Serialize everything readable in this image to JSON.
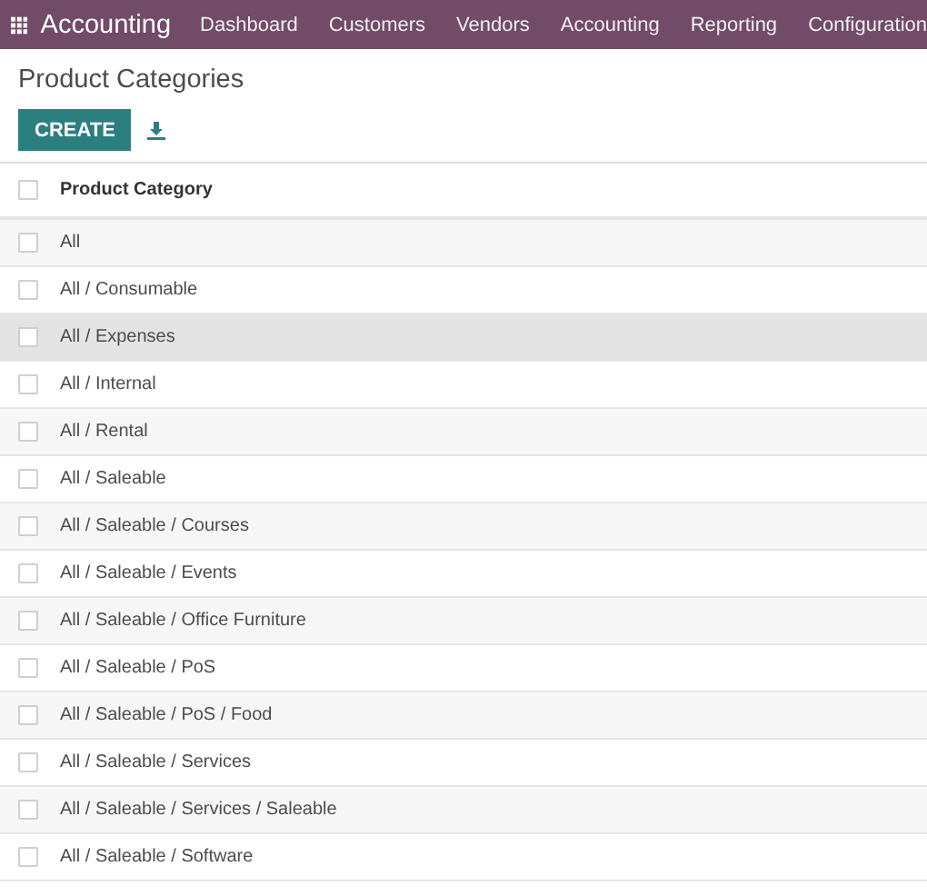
{
  "navbar": {
    "app_name": "Accounting",
    "menu": [
      "Dashboard",
      "Customers",
      "Vendors",
      "Accounting",
      "Reporting",
      "Configuration"
    ]
  },
  "page": {
    "title": "Product Categories",
    "create_button": "CREATE"
  },
  "table": {
    "columns": [
      "Product Category"
    ],
    "header_checked": false,
    "rows": [
      {
        "name": "All",
        "checked": false,
        "hovered": false
      },
      {
        "name": "All / Consumable",
        "checked": false,
        "hovered": false
      },
      {
        "name": "All / Expenses",
        "checked": false,
        "hovered": true
      },
      {
        "name": "All / Internal",
        "checked": false,
        "hovered": false
      },
      {
        "name": "All / Rental",
        "checked": false,
        "hovered": false
      },
      {
        "name": "All / Saleable",
        "checked": false,
        "hovered": false
      },
      {
        "name": "All / Saleable / Courses",
        "checked": false,
        "hovered": false
      },
      {
        "name": "All / Saleable / Events",
        "checked": false,
        "hovered": false
      },
      {
        "name": "All / Saleable / Office Furniture",
        "checked": false,
        "hovered": false
      },
      {
        "name": "All / Saleable / PoS",
        "checked": false,
        "hovered": false
      },
      {
        "name": "All / Saleable / PoS / Food",
        "checked": false,
        "hovered": false
      },
      {
        "name": "All / Saleable / Services",
        "checked": false,
        "hovered": false
      },
      {
        "name": "All / Saleable / Services / Saleable",
        "checked": false,
        "hovered": false
      },
      {
        "name": "All / Saleable / Software",
        "checked": false,
        "hovered": false
      }
    ]
  }
}
